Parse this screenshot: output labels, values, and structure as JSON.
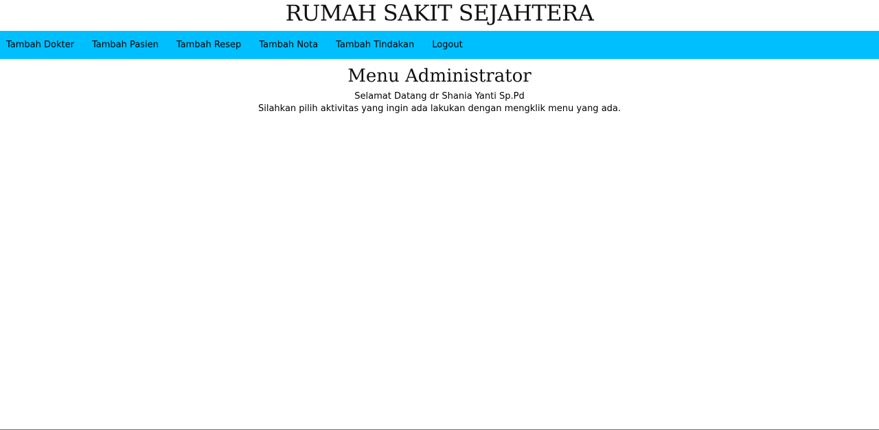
{
  "header": {
    "site_title": "RUMAH SAKIT SEJAHTERA"
  },
  "nav": {
    "background_color": "#00bfff",
    "items": [
      {
        "label": "Tambah Dokter"
      },
      {
        "label": "Tambah Pasien"
      },
      {
        "label": "Tambah Resep"
      },
      {
        "label": "Tambah Nota"
      },
      {
        "label": "Tambah Tindakan"
      },
      {
        "label": "Logout"
      }
    ]
  },
  "main": {
    "heading": "Menu Administrator",
    "welcome_text": "Selamat Datang dr Shania Yanti Sp.Pd",
    "instruction_text": "Silahkan pilih aktivitas yang ingin ada lakukan dengan mengklik menu yang ada."
  }
}
